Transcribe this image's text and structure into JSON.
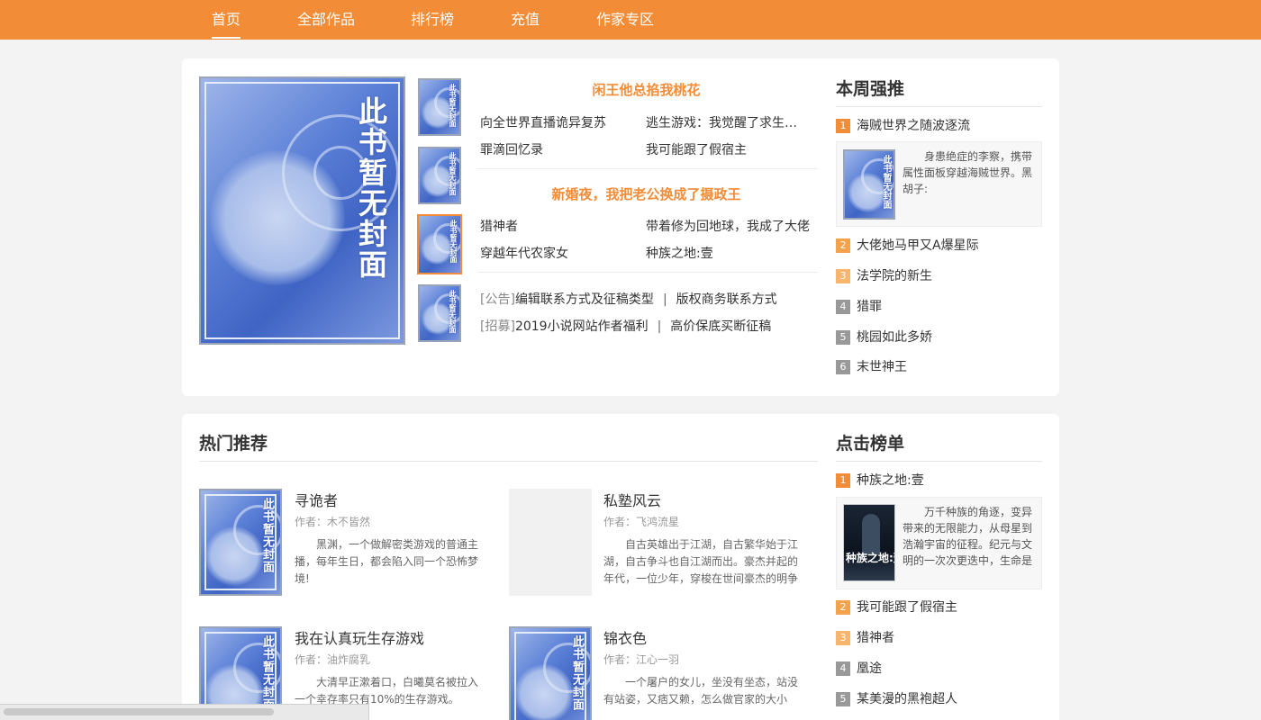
{
  "nav": {
    "items": [
      {
        "label": "首页",
        "active": true
      },
      {
        "label": "全部作品"
      },
      {
        "label": "排行榜"
      },
      {
        "label": "充值"
      },
      {
        "label": "作家专区"
      }
    ]
  },
  "cover_placeholder": "此书暂无封面",
  "featured": {
    "group1": {
      "headline": "闲王他总掐我桃花",
      "links": [
        "向全世界直播诡异复苏",
        "逃生游戏：我觉醒了求生模…",
        "罪滴回忆录",
        "我可能跟了假宿主"
      ]
    },
    "group2": {
      "headline": "新婚夜，我把老公换成了摄政王",
      "links": [
        "猎神者",
        "带着修为回地球，我成了大佬",
        "穿越年代农家女",
        "种族之地:壹"
      ]
    },
    "notices": [
      {
        "tag": "[公告]",
        "first": "编辑联系方式及征稿类型",
        "sep": "|",
        "second": "版权商务联系方式"
      },
      {
        "tag": "[招募]",
        "first": "2019小说网站作者福利",
        "sep": "|",
        "second": "高价保底买断征稿"
      }
    ]
  },
  "weekly": {
    "title": "本周强推",
    "items": [
      {
        "rank": "1",
        "name": "海贼世界之随波逐流"
      },
      {
        "rank": "2",
        "name": "大佬她马甲又A爆星际"
      },
      {
        "rank": "3",
        "name": "法学院的新生"
      },
      {
        "rank": "4",
        "name": "猎罪"
      },
      {
        "rank": "5",
        "name": "桃园如此多娇"
      },
      {
        "rank": "6",
        "name": "末世神王"
      }
    ],
    "top_desc": "身患绝症的李察，携带属性面板穿越海贼世界。黑胡子:"
  },
  "hot": {
    "title": "热门推荐",
    "books": [
      {
        "title": "寻诡者",
        "author": "作者：木不皆然",
        "desc": "黑渊，一个做解密类游戏的普通主播，每年生日，都会陷入同一个恐怖梦境!"
      },
      {
        "title": "私塾风云",
        "author": "作者：飞鸿流星",
        "desc": "自古英雄出于江湖，自古繁华始于江湖，自古争斗也自江湖而出。豪杰并起的年代，一位少年，穿梭在世间豪杰的明争暗斗"
      },
      {
        "title": "我在认真玩生存游戏",
        "author": "作者：油炸腐乳",
        "desc": "大清早正漱着口，白曦莫名被拉入一个幸存率只有10%的生存游戏。"
      },
      {
        "title": "锦衣色",
        "author": "作者：江心一羽",
        "desc": "一个屠户的女儿，坐没有坐态，站没有站姿，又痞又赖，怎么做官家的大小姐?"
      }
    ]
  },
  "clicks": {
    "title": "点击榜单",
    "items": [
      {
        "rank": "1",
        "name": "种族之地:壹"
      },
      {
        "rank": "2",
        "name": "我可能跟了假宿主"
      },
      {
        "rank": "3",
        "name": "猎神者"
      },
      {
        "rank": "4",
        "name": "凰途"
      },
      {
        "rank": "5",
        "name": "某美漫的黑袍超人"
      }
    ],
    "top_desc": "万千种族的角逐，变异带来的无限能力，从母星到浩瀚宇宙的征程。纪元与文明的一次次更迭中，生命是否",
    "top_cover_text": "种族之地:壹"
  }
}
